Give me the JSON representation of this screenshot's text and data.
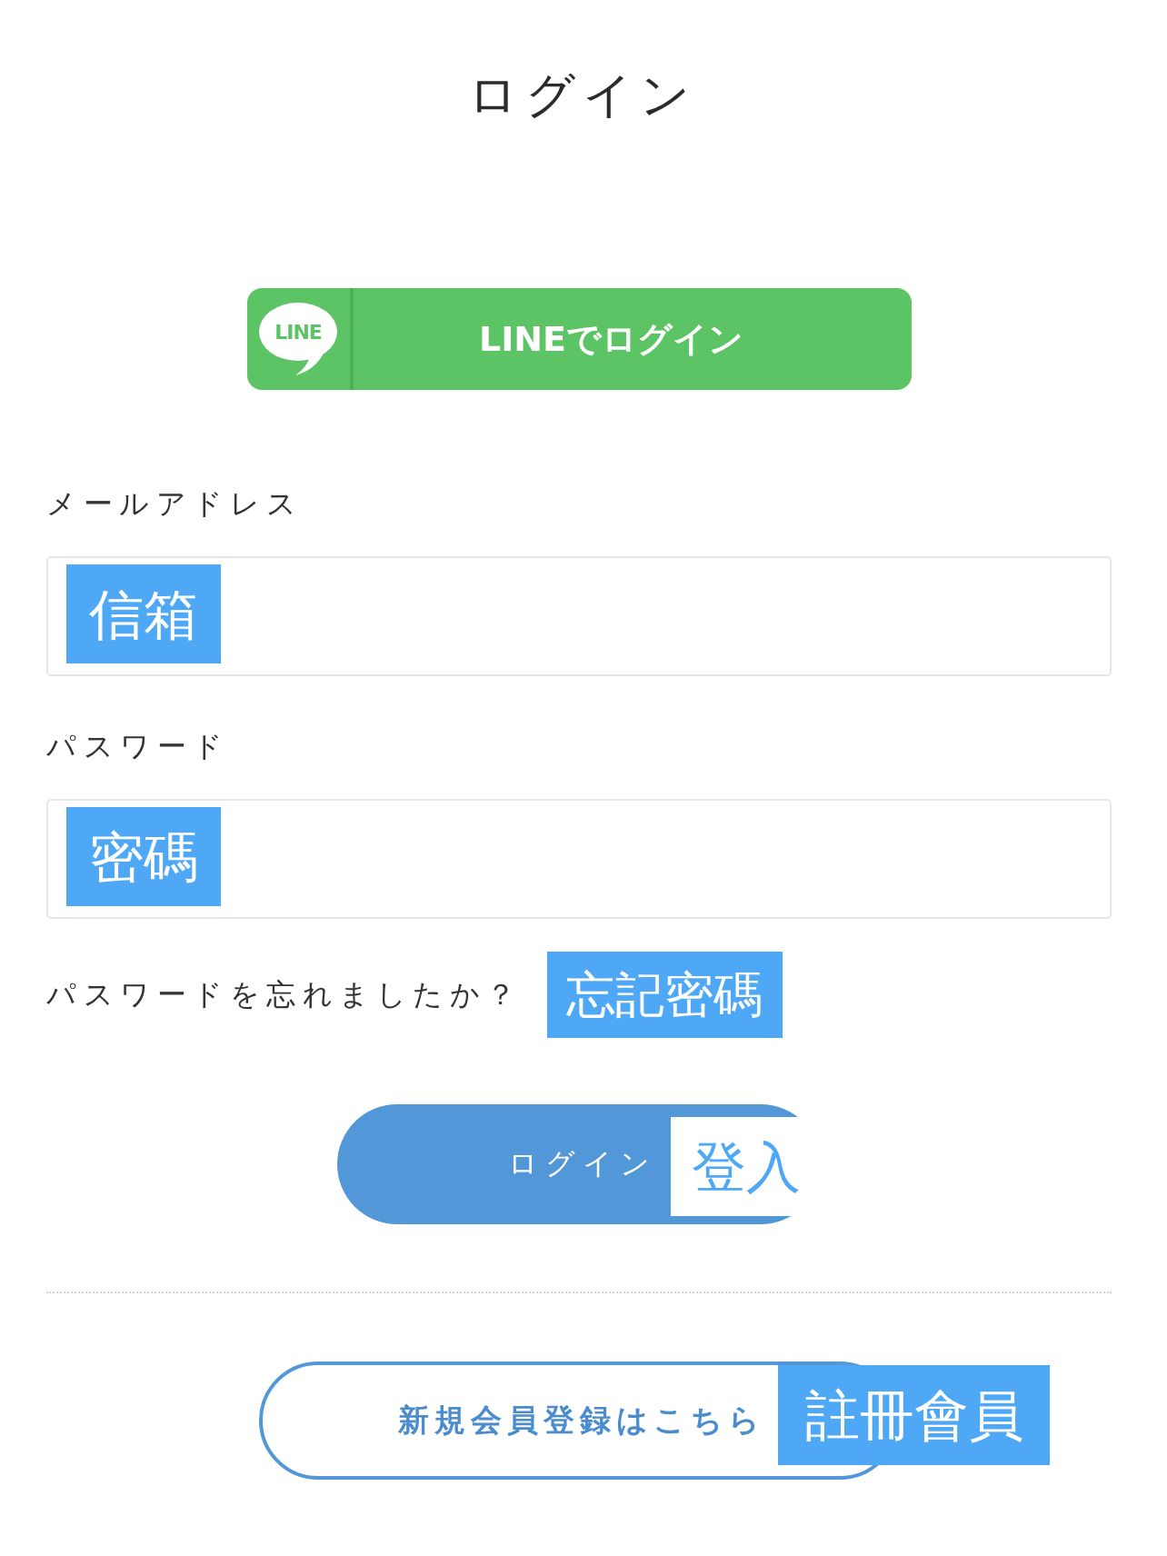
{
  "title": "ログイン",
  "line_button": {
    "logo_text": "LINE",
    "label": "LINEでログイン"
  },
  "email_field": {
    "label": "メールアドレス",
    "annotation": "信箱"
  },
  "password_field": {
    "label": "パスワード",
    "annotation": "密碼"
  },
  "forgot_password": {
    "link": "パスワードを忘れましたか？",
    "annotation": "忘記密碼"
  },
  "login_button": {
    "label": "ログイン",
    "annotation": "登入"
  },
  "register_button": {
    "label": "新規会員登録はこちら",
    "annotation": "註冊會員"
  }
}
